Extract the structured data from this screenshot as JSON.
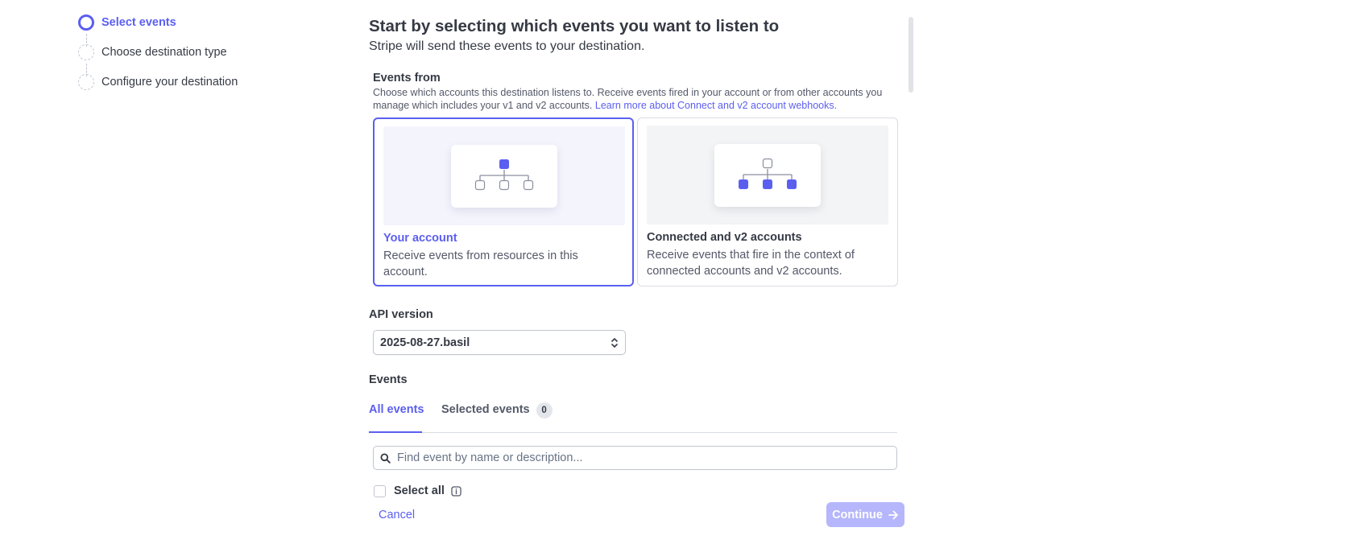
{
  "stepper": {
    "steps": [
      {
        "label": "Select events",
        "state": "active"
      },
      {
        "label": "Choose destination type",
        "state": "todo"
      },
      {
        "label": "Configure your destination",
        "state": "todo"
      }
    ]
  },
  "header": {
    "title": "Start by selecting which events you want to listen to",
    "subtitle": "Stripe will send these events to your destination."
  },
  "events_from": {
    "label": "Events from",
    "description": "Choose which accounts this destination listens to. Receive events fired in your account or from other accounts you manage which includes your v1 and v2 accounts.",
    "link_text": "Learn more about Connect and v2 account webhooks.",
    "options": [
      {
        "title": "Your account",
        "description": "Receive events from resources in this account.",
        "selected": true,
        "icon": "org-tree-top-icon"
      },
      {
        "title": "Connected and v2 accounts",
        "description": "Receive events that fire in the context of connected accounts and v2 accounts.",
        "selected": false,
        "icon": "org-tree-children-icon"
      }
    ]
  },
  "api_version": {
    "label": "API version",
    "value": "2025-08-27.basil"
  },
  "events": {
    "label": "Events",
    "tabs": [
      {
        "label": "All events",
        "active": true
      },
      {
        "label": "Selected events",
        "active": false,
        "count": "0"
      }
    ],
    "search_placeholder": "Find event by name or description...",
    "select_all_label": "Select all"
  },
  "footer": {
    "cancel_label": "Cancel",
    "continue_label": "Continue"
  },
  "colors": {
    "accent": "#5b5ff0",
    "continue_disabled": "#b5b6fb",
    "text": "#353a44",
    "border": "#d8dce3"
  }
}
